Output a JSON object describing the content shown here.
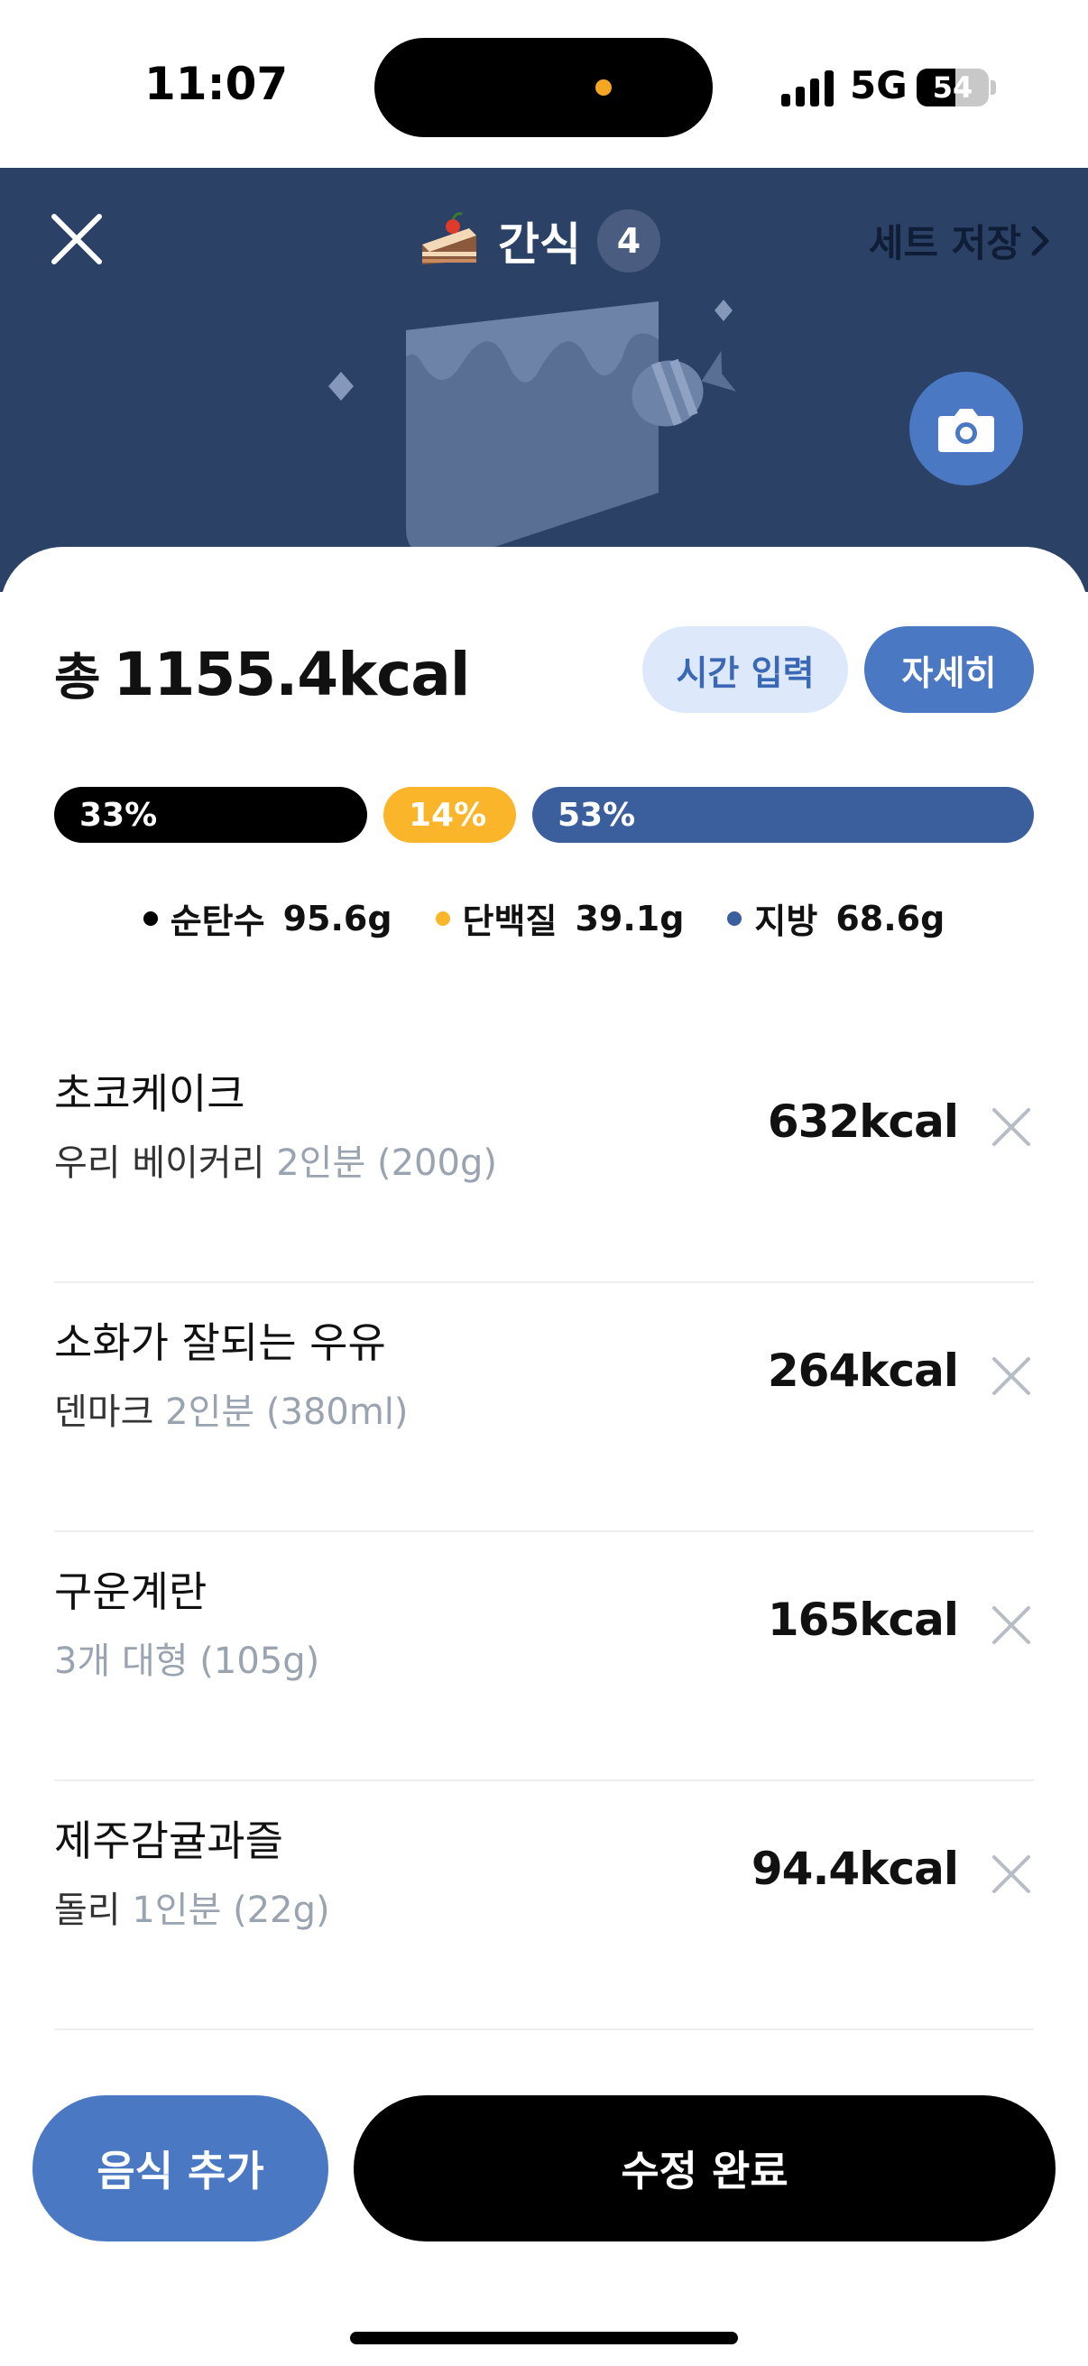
{
  "status_bar": {
    "time": "11:07",
    "network": "5G",
    "battery": "54",
    "battery_level": 0.54
  },
  "header": {
    "title": "간식",
    "count": "4",
    "save_set_label": "세트 저장",
    "background_color": "#2b4166"
  },
  "summary": {
    "total_prefix": "총",
    "total_kcal": "1155.4kcal",
    "time_input_label": "시간 입력",
    "detail_label": "자세히"
  },
  "macros": {
    "carbs": {
      "percent": "33%",
      "fraction": 0.33,
      "label": "순탄수",
      "value": "95.6g",
      "color": "#000000"
    },
    "protein": {
      "percent": "14%",
      "fraction": 0.14,
      "label": "단백질",
      "value": "39.1g",
      "color": "#fbb52a"
    },
    "fat": {
      "percent": "53%",
      "fraction": 0.53,
      "label": "지방",
      "value": "68.6g",
      "color": "#3b5f9c"
    }
  },
  "foods": [
    {
      "name": "초코케이크",
      "brand": "우리 베이커리",
      "portion": "2인분 (200g)",
      "kcal": "632kcal"
    },
    {
      "name": "소화가 잘되는 우유",
      "brand": "덴마크",
      "portion": "2인분 (380ml)",
      "kcal": "264kcal"
    },
    {
      "name": "구운계란",
      "brand": "",
      "portion": "3개 대형 (105g)",
      "kcal": "165kcal"
    },
    {
      "name": "제주감귤과즐",
      "brand": "돌리",
      "portion": "1인분 (22g)",
      "kcal": "94.4kcal"
    }
  ],
  "actions": {
    "add_food_label": "음식 추가",
    "done_label": "수정 완료"
  },
  "colors": {
    "accent": "#4a78c2",
    "light_accent": "#dde9fb"
  }
}
